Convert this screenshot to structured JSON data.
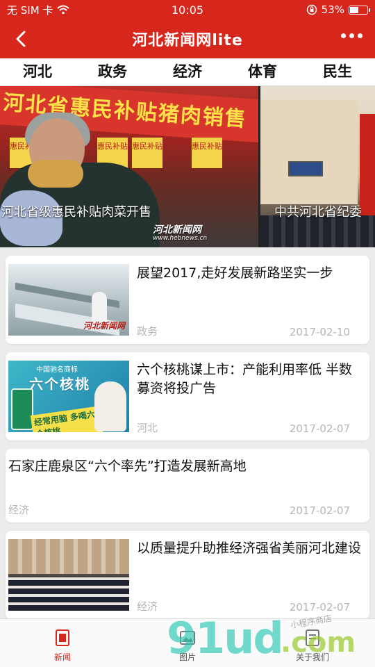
{
  "status_bar": {
    "carrier": "无 SIM 卡",
    "time": "10:05",
    "battery": "53%",
    "battery_level": 0.53
  },
  "nav": {
    "title": "河北新闻网lite"
  },
  "tabs": [
    "河北",
    "政务",
    "经济",
    "体育",
    "民生"
  ],
  "banner": {
    "slides": [
      {
        "caption": "河北省级惠民补贴肉菜开售",
        "sign_text": "河北省惠民补贴猪肉销售",
        "posters": [
          "惠民补贴",
          "惠民补贴",
          "惠民补贴",
          "惠民补贴"
        ],
        "logo": "河北新闻网",
        "logo_url": "www.hebnews.cn"
      },
      {
        "caption": "中共河北省纪委"
      }
    ]
  },
  "news": [
    {
      "title": "展望2017,走好发展新路坚实一步",
      "category": "政务",
      "date": "2017-02-10",
      "has_image": true,
      "image_mark": "河北新闻网"
    },
    {
      "title": "六个核桃谋上市：产能利用率低 半数募资将投广告",
      "category": "河北",
      "date": "2017-02-07",
      "has_image": true,
      "image_brand": "中国驰名商标",
      "image_title": "六个核桃",
      "image_slogan": "经常用脑 多喝六个核桃"
    },
    {
      "title": "石家庄鹿泉区“六个率先”打造发展新高地",
      "category": "经济",
      "date": "2017-02-07",
      "has_image": false
    },
    {
      "title": "以质量提升助推经济强省美丽河北建设",
      "category": "经济",
      "date": "2017-02-07",
      "has_image": true
    }
  ],
  "bottom_tabs": [
    {
      "label": "新闻",
      "icon": "news-icon",
      "active": true
    },
    {
      "label": "图片",
      "icon": "image-icon",
      "active": false
    },
    {
      "label": "关于我们",
      "icon": "about-icon",
      "active": false
    }
  ],
  "watermark": {
    "text_main": "91ud",
    "text_suffix": ".com",
    "text_shop": "小程序商店"
  },
  "colors": {
    "brand_red": "#d7261b",
    "meta_gray": "#b5b5b5"
  }
}
